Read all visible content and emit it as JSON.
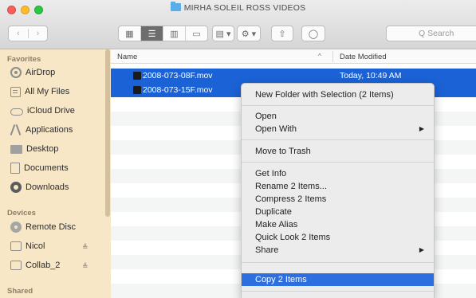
{
  "window": {
    "title": "MIRHA SOLEIL ROSS VIDEOS"
  },
  "toolbar": {
    "back": "‹",
    "forward": "›",
    "view_icons": [
      "▦",
      "☰",
      "▥",
      "▭"
    ],
    "arrange": "▤ ▾",
    "action": "⚙ ▾",
    "share": "⇧",
    "tags": "◯",
    "search_placeholder": "Q Search"
  },
  "sidebar": {
    "favorites_header": "Favorites",
    "favorites": [
      {
        "label": "AirDrop",
        "icon": "airdrop-icon"
      },
      {
        "label": "All My Files",
        "icon": "all-files-icon"
      },
      {
        "label": "iCloud Drive",
        "icon": "icloud-icon"
      },
      {
        "label": "Applications",
        "icon": "applications-icon"
      },
      {
        "label": "Desktop",
        "icon": "desktop-icon"
      },
      {
        "label": "Documents",
        "icon": "documents-icon"
      },
      {
        "label": "Downloads",
        "icon": "downloads-icon"
      }
    ],
    "devices_header": "Devices",
    "devices": [
      {
        "label": "Remote Disc",
        "icon": "remote-disc-icon"
      },
      {
        "label": "Nicol",
        "icon": "drive-icon",
        "eject": "≜"
      },
      {
        "label": "Collab_2",
        "icon": "drive-icon",
        "eject": "≜"
      }
    ],
    "shared_header": "Shared"
  },
  "list": {
    "col_name": "Name",
    "sort_indicator": "^",
    "col_date": "Date Modified",
    "files": [
      {
        "name": "2008-073-08F.mov",
        "date": "Today, 10:49 AM"
      },
      {
        "name": "2008-073-15F.mov",
        "date": ""
      }
    ]
  },
  "menu": {
    "new_folder": "New Folder with Selection (2 Items)",
    "open": "Open",
    "open_with": "Open With",
    "move_to_trash": "Move to Trash",
    "get_info": "Get Info",
    "rename": "Rename 2 Items...",
    "compress": "Compress 2 Items",
    "duplicate": "Duplicate",
    "make_alias": "Make Alias",
    "quick_look": "Quick Look 2 Items",
    "share": "Share",
    "copy": "Copy 2 Items",
    "submenu_arrow": "▶"
  },
  "colors": {
    "selection": "#1a62d6",
    "menu_highlight": "#2d6fe0",
    "sidebar_bg": "#f7e7c7"
  }
}
